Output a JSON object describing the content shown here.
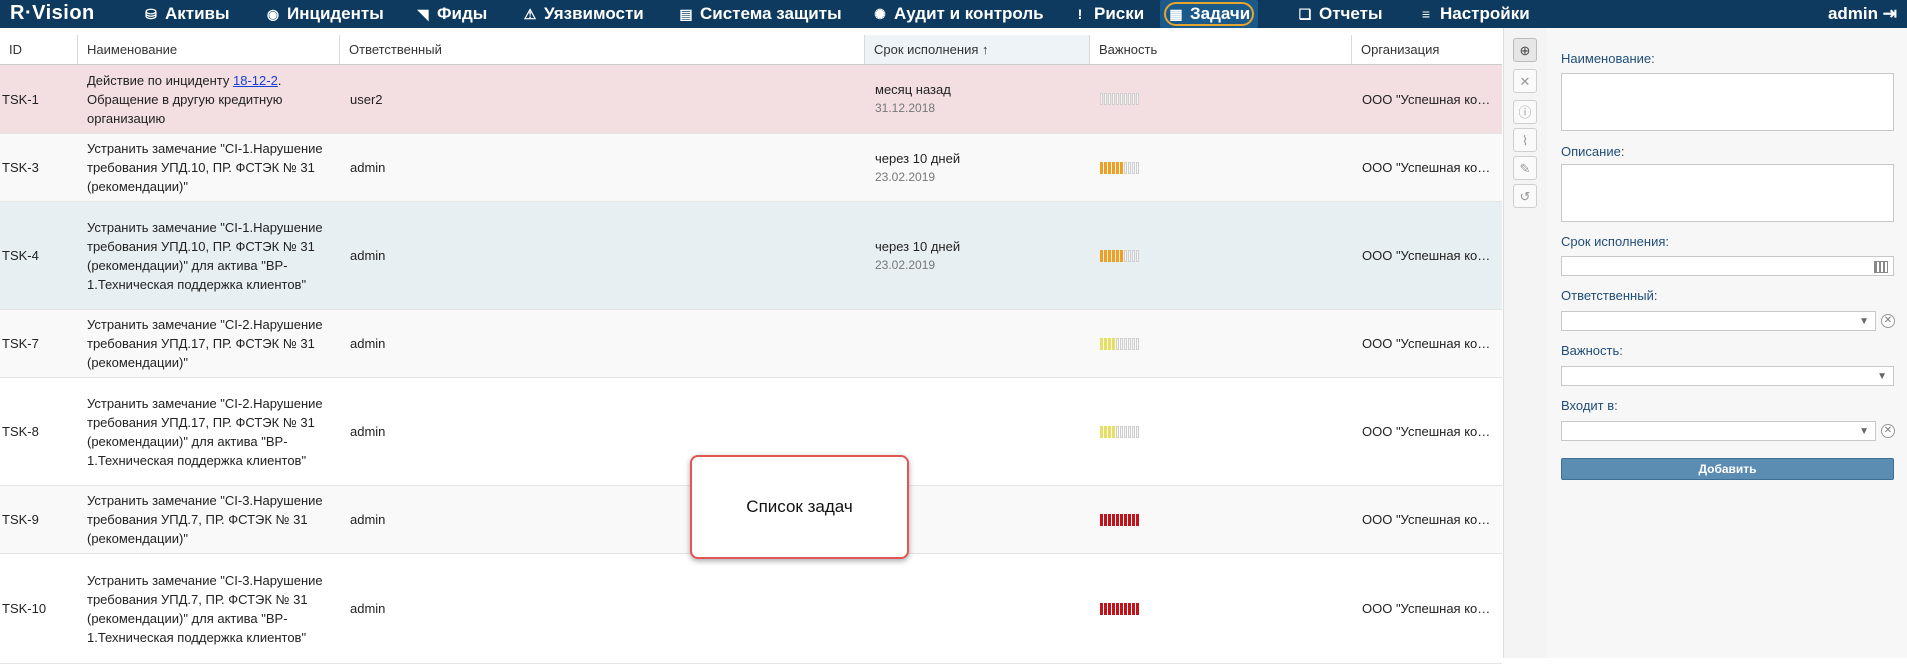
{
  "app": {
    "logo": "R·Vision",
    "user": "admin"
  },
  "nav": [
    {
      "id": "assets",
      "icon": "⛁",
      "icon_name": "database-icon",
      "label": "Активы"
    },
    {
      "id": "incidents",
      "icon": "◉",
      "icon_name": "target-icon",
      "label": "Инциденты"
    },
    {
      "id": "feeds",
      "icon": "◥",
      "icon_name": "rss-icon",
      "label": "Фиды"
    },
    {
      "id": "vulns",
      "icon": "⚠",
      "icon_name": "warning-icon",
      "label": "Уязвимости"
    },
    {
      "id": "protection",
      "icon": "▤",
      "icon_name": "server-icon",
      "label": "Система защиты"
    },
    {
      "id": "audit",
      "icon": "✺",
      "icon_name": "gear-cycle-icon",
      "label": "Аудит и контроль"
    },
    {
      "id": "risks",
      "icon": "!",
      "icon_name": "alert-circle-icon",
      "label": "Риски"
    },
    {
      "id": "tasks",
      "icon": "▦",
      "icon_name": "tasks-icon",
      "label": "Задачи",
      "active": true
    },
    {
      "id": "reports",
      "icon": "❏",
      "icon_name": "reports-icon",
      "label": "Отчеты"
    },
    {
      "id": "settings",
      "icon": "≡",
      "icon_name": "menu-icon",
      "label": "Настройки"
    }
  ],
  "table": {
    "columns": {
      "id": "ID",
      "name": "Наименование",
      "resp": "Ответственный",
      "due": "Срок исполнения ↑",
      "imp": "Важность",
      "org": "Организация"
    },
    "rows": [
      {
        "id": "TSK-1",
        "name_prefix": "Действие по инциденту ",
        "name_link": "18-12-2",
        "name_suffix": ". Обращение в другую кредитную организацию",
        "resp": "user2",
        "due": "месяц назад",
        "due_date": "31.12.2018",
        "importance": 0,
        "imp_color": "#cccccc",
        "org": "ООО \"Успешная компания\"",
        "bg": "#f3dfe1"
      },
      {
        "id": "TSK-3",
        "name_prefix": "Устранить замечание \"CI-1.Нарушение требования УПД.10, ПР. ФСТЭК № 31 (рекомендации)\"",
        "resp": "admin",
        "due": "через 10 дней",
        "due_date": "23.02.2019",
        "importance": 0.6,
        "imp_color": "#f0a020",
        "org": "ООО \"Успешная компания\"",
        "bg": "#f9f9f9"
      },
      {
        "id": "TSK-4",
        "name_prefix": "Устранить замечание \"CI-1.Нарушение требования УПД.10, ПР. ФСТЭК № 31 (рекомендации)\" для актива \"BP-1.Техническая поддержка клиентов\"",
        "resp": "admin",
        "due": "через 10 дней",
        "due_date": "23.02.2019",
        "importance": 0.6,
        "imp_color": "#f0a020",
        "org": "ООО \"Успешная компания\"",
        "bg": "#e8eff3"
      },
      {
        "id": "TSK-7",
        "name_prefix": "Устранить замечание \"CI-2.Нарушение требования УПД.17, ПР. ФСТЭК № 31 (рекомендации)\"",
        "resp": "admin",
        "due": "",
        "due_date": "",
        "importance": 0.4,
        "imp_color": "#e6e060",
        "org": "ООО \"Успешная компания\"",
        "bg": "#f9f9f9"
      },
      {
        "id": "TSK-8",
        "name_prefix": "Устранить замечание \"CI-2.Нарушение требования УПД.17, ПР. ФСТЭК № 31 (рекомендации)\" для актива \"BP-1.Техническая поддержка клиентов\"",
        "resp": "admin",
        "due": "",
        "due_date": "",
        "importance": 0.4,
        "imp_color": "#e6e060",
        "org": "ООО \"Успешная компания\"",
        "bg": "#ffffff"
      },
      {
        "id": "TSK-9",
        "name_prefix": "Устранить замечание \"CI-3.Нарушение требования УПД.7, ПР. ФСТЭК № 31 (рекомендации)\"",
        "resp": "admin",
        "due": "",
        "due_date": "",
        "importance": 1.0,
        "imp_color": "#c4121a",
        "org": "ООО \"Успешная компания\"",
        "bg": "#f9f9f9"
      },
      {
        "id": "TSK-10",
        "name_prefix": "Устранить замечание \"CI-3.Нарушение требования УПД.7, ПР. ФСТЭК № 31 (рекомендации)\" для актива \"BP-1.Техническая поддержка клиентов\"",
        "resp": "admin",
        "due": "",
        "due_date": "",
        "importance": 1.0,
        "imp_color": "#c4121a",
        "org": "ООО \"Успешная компания\"",
        "bg": "#ffffff"
      }
    ]
  },
  "callout": "Список задач",
  "toolbar": [
    {
      "icon": "⊕",
      "name": "add-icon",
      "primary": true
    },
    {
      "icon": "✕",
      "name": "close-icon"
    },
    {
      "icon": "ⓘ",
      "name": "info-icon"
    },
    {
      "icon": "⌇",
      "name": "attachment-icon"
    },
    {
      "icon": "✎",
      "name": "comment-icon"
    },
    {
      "icon": "↺",
      "name": "history-icon"
    }
  ],
  "form": {
    "name_label": "Наименование:",
    "desc_label": "Описание:",
    "due_label": "Срок исполнения:",
    "resp_label": "Ответственный:",
    "imp_label": "Важность:",
    "parent_label": "Входит в:",
    "add_button": "Добавить"
  }
}
